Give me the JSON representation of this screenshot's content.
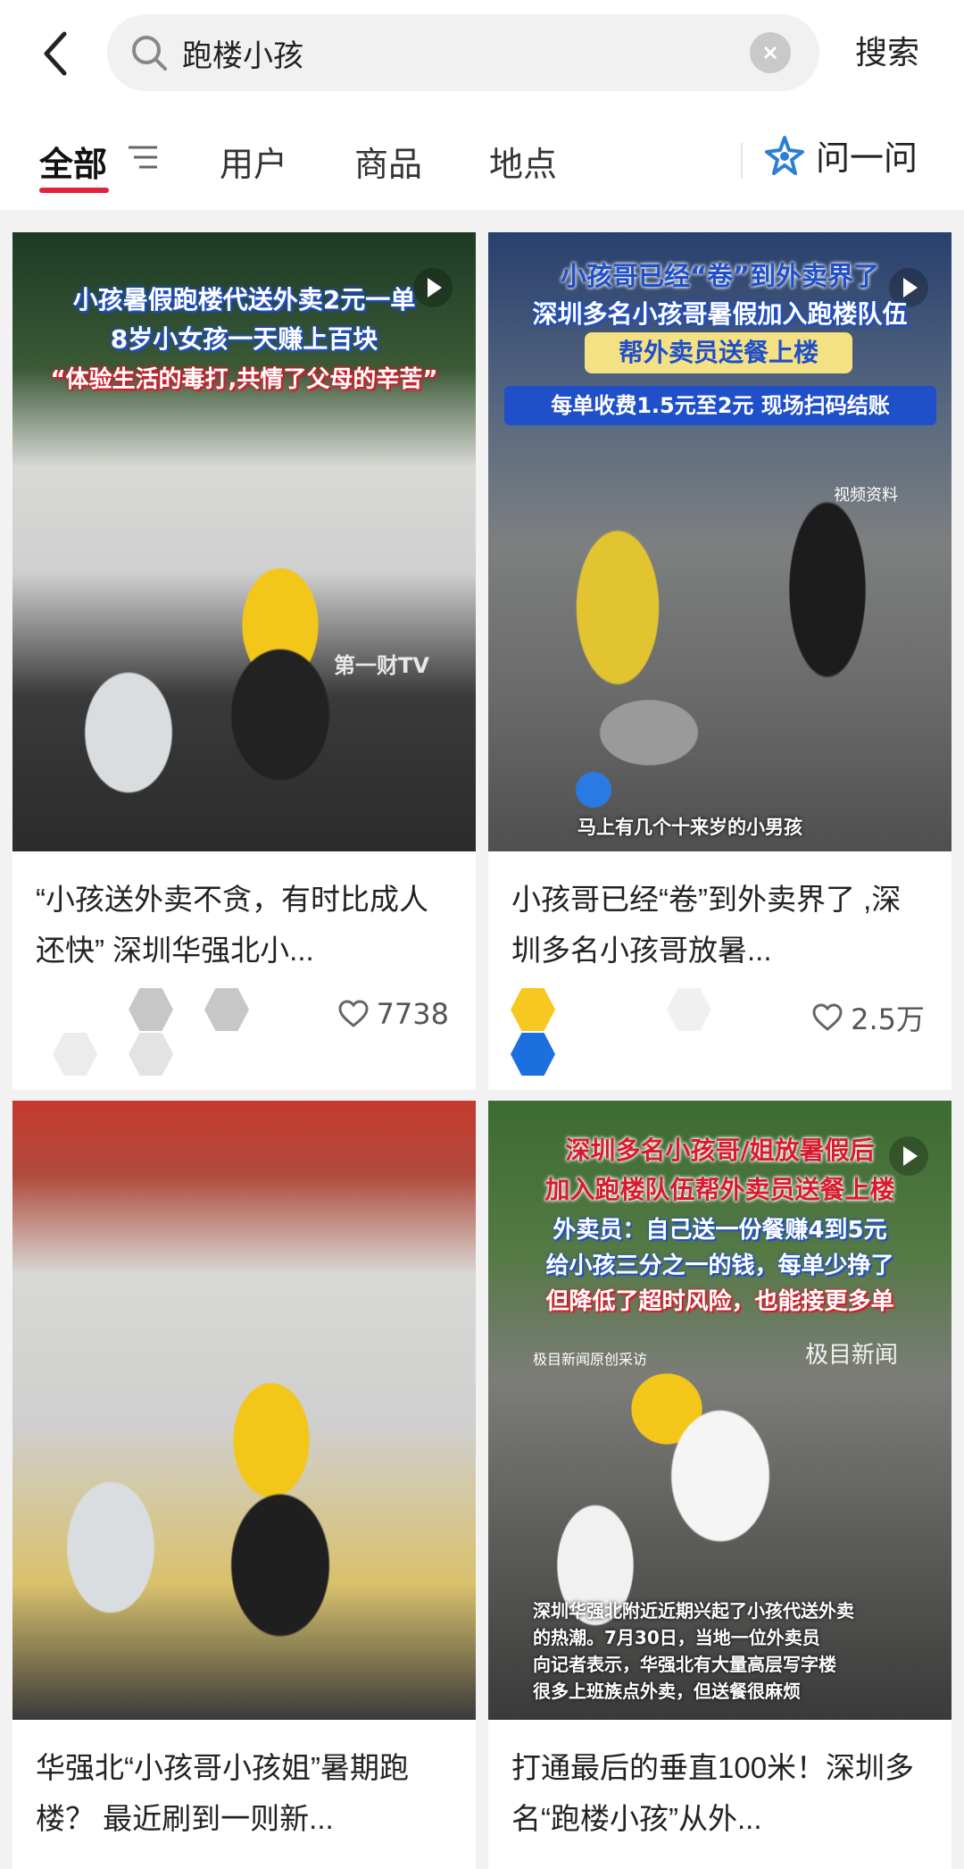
{
  "header": {
    "query": "跑楼小孩",
    "search_button": "搜索"
  },
  "tabs": {
    "all": "全部",
    "users": "用户",
    "products": "商品",
    "places": "地点",
    "ask": "问一问"
  },
  "posts": [
    {
      "overlay_lines": [
        "小孩暑假跑楼代送外卖2元一单",
        "8岁小女孩一天赚上百块",
        "“体验生活的毒打,共情了父母的辛苦”"
      ],
      "watermark": "第一财TV",
      "caption": "“小孩送外卖不贪，有时比成人还快” 深圳华强北小...",
      "likes": "7738"
    },
    {
      "overlay_lines": [
        "小孩哥已经“卷”到外卖界了",
        "深圳多名小孩哥暑假加入跑楼队伍",
        "帮外卖员送餐上楼",
        "每单收费1.5元至2元 现场扫码结账"
      ],
      "watermark": "视频资料",
      "subtitle": "马上有几个十来岁的小男孩",
      "caption": "小孩哥已经“卷”到外卖界了 ,深圳多名小孩哥放暑...",
      "likes": "2.5万"
    },
    {
      "caption": "华强北“小孩哥小孩姐”暑期跑楼？ 最近刷到一则新..."
    },
    {
      "overlay_lines": [
        "深圳多名小孩哥/姐放暑假后",
        "加入跑楼队伍帮外卖员送餐上楼",
        "外卖员：自己送一份餐赚4到5元",
        "给小孩三分之一的钱，每单少挣了",
        "但降低了超时风险，也能接更多单"
      ],
      "source": "极目新闻原创采访",
      "watermark": "极目新闻",
      "subtitle_lines": [
        "深圳华强北附近近期兴起了小孩代送外卖",
        "的热潮。7月30日，当地一位外卖员",
        "向记者表示，华强北有大量高层写字楼",
        "很多上班族点外卖，但送餐很麻烦"
      ],
      "caption": "打通最后的垂直100米！深圳多名“跑楼小孩”从外..."
    }
  ],
  "colors": {
    "accent": "#e2233c",
    "overlay_blue": "#1f4fc9",
    "overlay_red": "#d81b2c"
  }
}
